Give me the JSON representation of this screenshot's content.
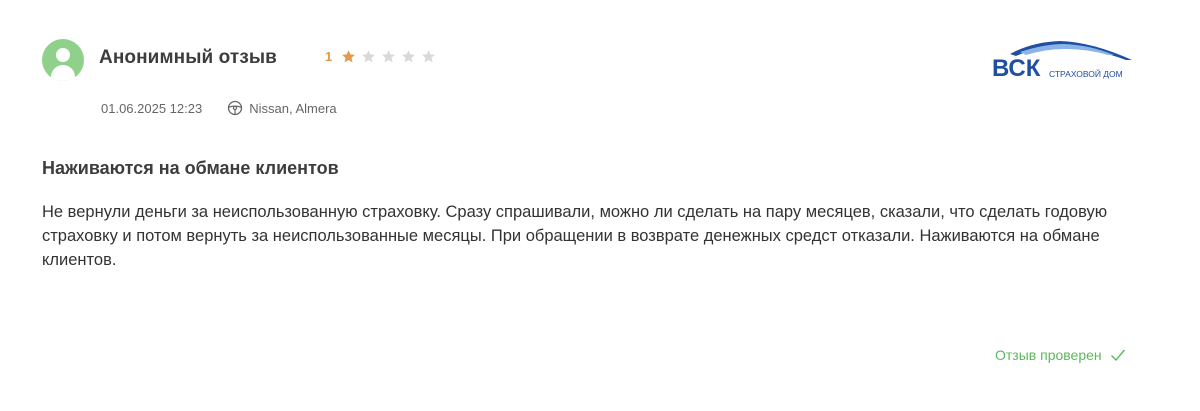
{
  "review": {
    "author_name": "Анонимный отзыв",
    "rating_value": "1",
    "rating_max": 5,
    "stars": [
      {
        "icon": "star-filled-icon",
        "color": "#e39a4a"
      },
      {
        "icon": "star-empty-icon",
        "color": "#d9d9d9"
      },
      {
        "icon": "star-empty-icon",
        "color": "#d9d9d9"
      },
      {
        "icon": "star-empty-icon",
        "color": "#d9d9d9"
      },
      {
        "icon": "star-empty-icon",
        "color": "#d9d9d9"
      }
    ],
    "date": "01.06.2025 12:23",
    "car": "Nissan, Almera",
    "title": "Наживаются на обмане клиентов",
    "text": "Не вернули деньги за неиспользованную страховку. Сразу спрашивали, можно ли сделать на пару месяцев, сказали, что сделать годовую страховку и потом вернуть за неиспользованные месяцы. При обращении в возврате денежных средст отказали. Наживаются на обмане клиентов.",
    "verified_label": "Отзыв проверен"
  },
  "company": {
    "logo_text": "ВСК",
    "logo_subtext": "СТРАХОВОЙ ДОМ",
    "brand_color": "#1f4fa0"
  },
  "colors": {
    "avatar": "#8fd18a",
    "rating_accent": "#e39a4a",
    "verified": "#5cb85c"
  }
}
